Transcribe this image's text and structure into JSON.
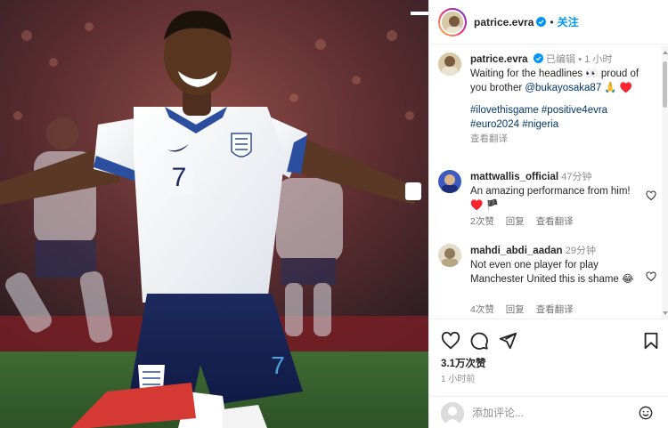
{
  "post": {
    "author": "patrice.evra",
    "follow_label": "关注",
    "separator": "•"
  },
  "caption": {
    "author": "patrice.evra",
    "edited": "已编辑",
    "dot": "•",
    "time": "1 小时",
    "text_before": "Waiting for the headlines 👀 proud of you brother ",
    "mention": "@bukayosaka87",
    "text_after": " 🙏 ♥️",
    "hashtags_line1": "#ilovethisgame #positive4evra",
    "hashtags_line2": "#euro2024 #nigeria",
    "translate": "查看翻译"
  },
  "comments": [
    {
      "user": "mattwallis_official",
      "age": "47分钟",
      "text": "An amazing performance from him! ♥️ 🏴",
      "likes": "2次赞",
      "reply": "回复",
      "translate": "查看翻译"
    },
    {
      "user": "mahdi_abdi_aadan",
      "age": "29分钟",
      "text": "Not even one player for play Manchester United this is shame 😂",
      "likes": "4次赞",
      "reply": "回复",
      "translate": "查看翻译"
    }
  ],
  "stats": {
    "likes": "3.1万次赞",
    "time": "1 小时前"
  },
  "comment_input": {
    "placeholder": "添加评论..."
  },
  "photo": {
    "jersey_number": "7"
  },
  "icons": {
    "like": "heart-icon",
    "comment": "comment-icon",
    "share": "send-icon",
    "save": "bookmark-icon",
    "emoji": "smiley-icon",
    "verified": "verified-badge-icon"
  },
  "colors": {
    "accent": "#0095f6",
    "verified": "#0095f6",
    "heart": "#ed4956",
    "link": "#00376b"
  }
}
